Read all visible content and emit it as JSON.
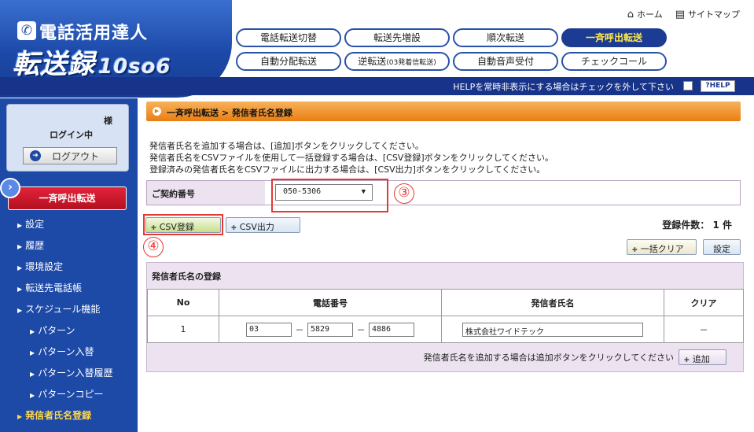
{
  "logo": {
    "phone_glyph": "✆",
    "title": "電話活用達人",
    "product": "転送録",
    "product_sub": "10so6"
  },
  "top_links": {
    "home": "ホーム",
    "sitemap": "サイトマップ"
  },
  "nav": {
    "row1": [
      "電話転送切替",
      "転送先増設",
      "順次転送",
      "一斉呼出転送"
    ],
    "row2_auto": "自動分配転送",
    "row2_reverse": "逆転送",
    "row2_reverse_small": "(03発着信転送)",
    "row2_voice": "自動音声受付",
    "row2_check": "チェックコール",
    "active": "一斉呼出転送"
  },
  "helpbar": {
    "text": "HELPを常時非表示にする場合はチェックを外して下さい",
    "help_button": "?HELP",
    "checked": false
  },
  "sidebar": {
    "sama": "様",
    "login_status": "ログイン中",
    "logout": "ログアウト",
    "current_feature": "一斉呼出転送",
    "items": [
      "設定",
      "履歴",
      "環境設定",
      "転送先電話帳",
      "スケジュール機能"
    ],
    "sub_items": [
      "パターン",
      "パターン入替",
      "パターン入替履歴",
      "パターンコピー"
    ],
    "active_item": "発信者氏名登録"
  },
  "breadcrumb": "一斉呼出転送 > 発信者氏名登録",
  "instructions": [
    "発信者氏名を追加する場合は、[追加]ボタンをクリックしてください。",
    "発信者氏名をCSVファイルを使用して一括登録する場合は、[CSV登録]ボタンをクリックしてください。",
    "登録済みの発信者氏名をCSVファイルに出力する場合は、[CSV出力]ボタンをクリックしてください。"
  ],
  "contract": {
    "label": "ご契約番号",
    "value": "050-5306"
  },
  "annotations": {
    "n3": "③",
    "n4": "④"
  },
  "buttons": {
    "csv_register": "CSV登録",
    "csv_export": "CSV出力",
    "bulk_clear": "一括クリア",
    "setting": "設定",
    "add": "追加"
  },
  "reg_count": "登録件数： 1 件",
  "panel_title": "発信者氏名の登録",
  "table": {
    "headers": [
      "No",
      "電話番号",
      "発信者氏名",
      "クリア"
    ],
    "rows": [
      {
        "no": "1",
        "phone1": "03",
        "phone2": "5829",
        "phone3": "4886",
        "name": "株式会社ワイドテック",
        "clear": "－"
      }
    ]
  },
  "add_hint": "発信者氏名を追加する場合は追加ボタンをクリックしてください",
  "colors": {
    "nav_blue": "#1c3b93",
    "sidebar_blue": "#1d49a7",
    "active_red": "#c8172a",
    "crumb_orange": "#f0921e",
    "highlight": "#e53935"
  }
}
